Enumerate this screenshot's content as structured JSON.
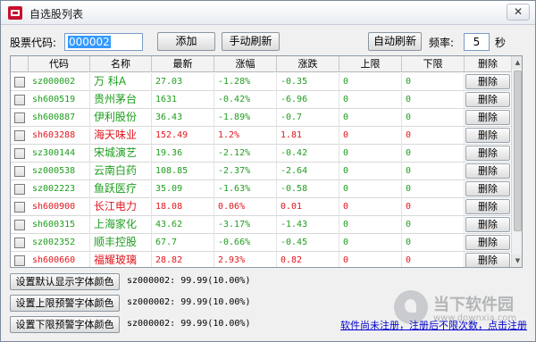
{
  "window": {
    "title": "自选股列表",
    "close_glyph": "✕"
  },
  "toolbar": {
    "code_label": "股票代码:",
    "code_value": "000002",
    "add_label": "添加",
    "manual_refresh_label": "手动刷新",
    "auto_refresh_label": "自动刷新",
    "freq_label": "频率:",
    "freq_value": "5",
    "freq_unit": "秒"
  },
  "table": {
    "columns": [
      "代码",
      "名称",
      "最新",
      "涨幅",
      "涨跌",
      "上限",
      "下限",
      "删除"
    ],
    "delete_label": "删除",
    "rows": [
      {
        "code": "sz000002",
        "name": "万 科A",
        "price": "27.03",
        "pct": "-1.28%",
        "chg": "-0.35",
        "upper": "0",
        "lower": "0",
        "color": "#1e9e1e"
      },
      {
        "code": "sh600519",
        "name": "贵州茅台",
        "price": "1631",
        "pct": "-0.42%",
        "chg": "-6.96",
        "upper": "0",
        "lower": "0",
        "color": "#1e9e1e"
      },
      {
        "code": "sh600887",
        "name": "伊利股份",
        "price": "36.43",
        "pct": "-1.89%",
        "chg": "-0.7",
        "upper": "0",
        "lower": "0",
        "color": "#1e9e1e"
      },
      {
        "code": "sh603288",
        "name": "海天味业",
        "price": "152.49",
        "pct": "1.2%",
        "chg": "1.81",
        "upper": "0",
        "lower": "0",
        "color": "#e0161d"
      },
      {
        "code": "sz300144",
        "name": "宋城演艺",
        "price": "19.36",
        "pct": "-2.12%",
        "chg": "-0.42",
        "upper": "0",
        "lower": "0",
        "color": "#1e9e1e"
      },
      {
        "code": "sz000538",
        "name": "云南白药",
        "price": "108.85",
        "pct": "-2.37%",
        "chg": "-2.64",
        "upper": "0",
        "lower": "0",
        "color": "#1e9e1e"
      },
      {
        "code": "sz002223",
        "name": "鱼跃医疗",
        "price": "35.09",
        "pct": "-1.63%",
        "chg": "-0.58",
        "upper": "0",
        "lower": "0",
        "color": "#1e9e1e"
      },
      {
        "code": "sh600900",
        "name": "长江电力",
        "price": "18.08",
        "pct": "0.06%",
        "chg": "0.01",
        "upper": "0",
        "lower": "0",
        "color": "#e0161d"
      },
      {
        "code": "sh600315",
        "name": "上海家化",
        "price": "43.62",
        "pct": "-3.17%",
        "chg": "-1.43",
        "upper": "0",
        "lower": "0",
        "color": "#1e9e1e"
      },
      {
        "code": "sz002352",
        "name": "顺丰控股",
        "price": "67.7",
        "pct": "-0.66%",
        "chg": "-0.45",
        "upper": "0",
        "lower": "0",
        "color": "#1e9e1e"
      },
      {
        "code": "sh600660",
        "name": "福耀玻璃",
        "price": "28.82",
        "pct": "2.93%",
        "chg": "0.82",
        "upper": "0",
        "lower": "0",
        "color": "#e0161d"
      }
    ]
  },
  "settings": [
    {
      "label": "设置默认显示字体颜色",
      "sample": "sz000002: 99.99(10.00%)",
      "sample_color": "#000000"
    },
    {
      "label": "设置上限预警字体颜色",
      "sample": "sz000002: 99.99(10.00%)",
      "sample_color": "#000000"
    },
    {
      "label": "设置下限预警字体颜色",
      "sample": "sz000002: 99.99(10.00%)",
      "sample_color": "#000000"
    }
  ],
  "register_link": "软件尚未注册，注册后不限次数，点击注册",
  "watermark": {
    "name": "当下软件园",
    "url": "www.downxia.com"
  },
  "icons": {
    "app": "app-logo-icon",
    "close": "close-icon",
    "scroll_up": "scroll-up-icon",
    "scroll_down": "scroll-down-icon",
    "checkbox": "checkbox-icon"
  }
}
